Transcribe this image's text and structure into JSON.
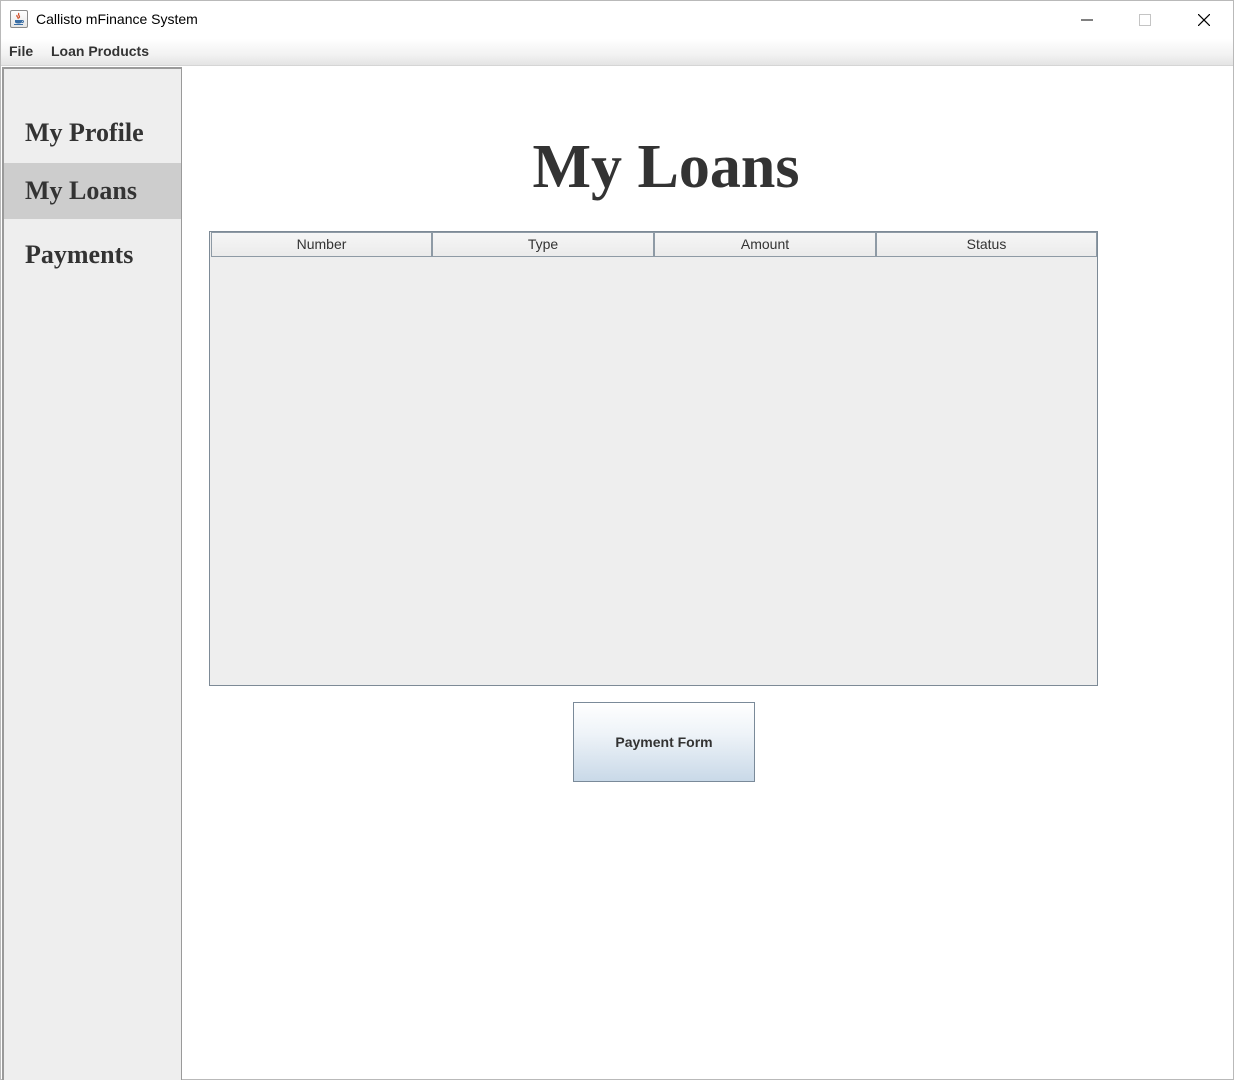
{
  "window": {
    "title": "Callisto mFinance System"
  },
  "menubar": {
    "items": [
      {
        "label": "File"
      },
      {
        "label": "Loan Products"
      }
    ]
  },
  "sidebar": {
    "items": [
      {
        "label": "My Profile",
        "selected": false
      },
      {
        "label": "My Loans",
        "selected": true
      },
      {
        "label": "Payments",
        "selected": false
      }
    ]
  },
  "main": {
    "title": "My Loans",
    "table": {
      "columns": [
        "Number",
        "Type",
        "Amount",
        "Status"
      ],
      "rows": []
    },
    "payment_button_label": "Payment Form"
  },
  "colors": {
    "selected_nav_bg": "#cdcdcd",
    "sidebar_bg": "#eeeeee",
    "text": "#333333"
  }
}
